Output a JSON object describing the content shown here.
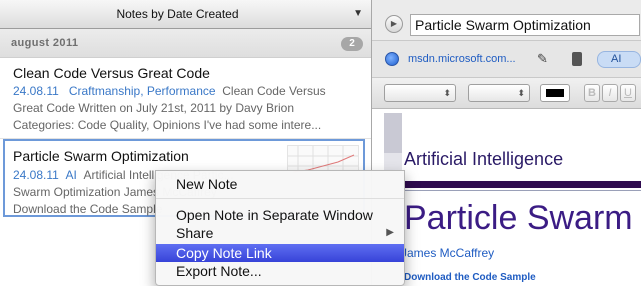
{
  "notes_list": {
    "sort_label": "Notes by Date Created",
    "group": {
      "label": "august 2011",
      "count": "2"
    },
    "notes": [
      {
        "title": "Clean Code Versus Great Code",
        "date": "24.08.11",
        "tags": "Craftmanship, Performance",
        "line1_rest": "Clean Code Versus",
        "line2": "Great Code Written on July 21st, 2011 by Davy Brion",
        "line3": "Categories: Code Quality, Opinions I've had some intere..."
      },
      {
        "title": "Particle Swarm Optimization",
        "date": "24.08.11",
        "tags": "AI",
        "line1_rest": "Artificial Intelligence Partic...",
        "line2": "Swarm Optimization James McCaffrey",
        "line3": "Download the Code Sample"
      }
    ]
  },
  "note_editor": {
    "title": "Particle Swarm Optimization",
    "url": "msdn.microsoft.com...",
    "tag": "AI",
    "content": {
      "section_heading": "Artificial Intelligence",
      "heading": "Particle Swarm Optimization",
      "author": "James McCaffrey",
      "download": "Download the Code Sample"
    },
    "format_buttons": [
      "B",
      "I",
      "U"
    ],
    "text_color": "#000000"
  },
  "context_menu": {
    "items": [
      {
        "label": "New Note"
      },
      {
        "label": "Open Note in Separate Window"
      },
      {
        "label": "Share",
        "submenu": true
      },
      {
        "label": "Copy Note Link",
        "highlighted": true
      },
      {
        "label": "Export Note..."
      }
    ]
  },
  "colors": {
    "accent": "#3743d8",
    "link": "#1f5cc2",
    "selection_border": "#6d99d9"
  }
}
